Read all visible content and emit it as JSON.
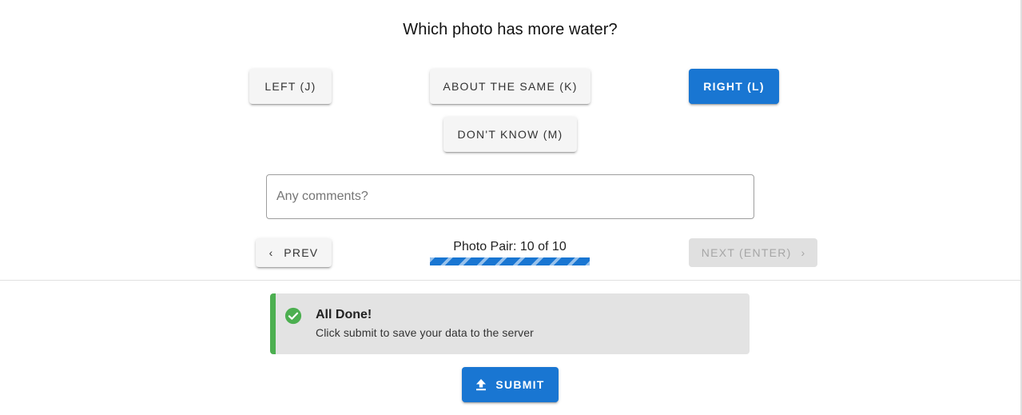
{
  "question": "Which photo has more water?",
  "choices": {
    "left_label": "LEFT (J)",
    "same_label": "ABOUT THE SAME (K)",
    "right_label": "RIGHT (L)",
    "dont_know_label": "DON'T KNOW (M)"
  },
  "comments": {
    "placeholder": "Any comments?",
    "value": ""
  },
  "navigation": {
    "prev_label": "PREV",
    "next_label": "NEXT (ENTER)",
    "pair_label": "Photo Pair: 10 of 10",
    "progress_fraction": 1.0
  },
  "alert": {
    "title": "All Done!",
    "message": "Click submit to save your data to the server"
  },
  "submit": {
    "label": "SUBMIT"
  },
  "colors": {
    "primary": "#1976d2",
    "success": "#4caf50",
    "alert_bg": "#e3e3e3",
    "button_bg": "#f5f5f5",
    "disabled_bg": "#e0e0e0"
  },
  "icons": {
    "prev": "chevron-left-icon",
    "next": "chevron-right-icon",
    "alert": "check-circle-icon",
    "submit": "upload-icon"
  }
}
